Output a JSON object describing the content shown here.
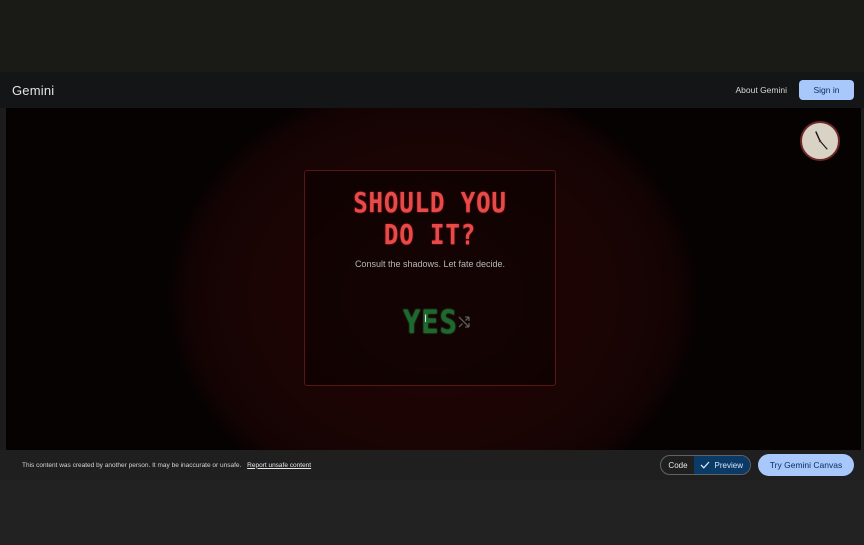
{
  "header": {
    "brand": "Gemini",
    "about_label": "About Gemini",
    "signin_label": "Sign in"
  },
  "app": {
    "title": "SHOULD YOU\nDO IT?",
    "subtitle": "Consult the shadows. Let fate decide.",
    "answer": "YES",
    "cursor_glyph": "I",
    "icons": {
      "clock": "clock-icon",
      "shuffle": "shuffle-icon"
    }
  },
  "footer": {
    "notice": "This content was created by another person. It may be inaccurate or unsafe.",
    "report_link": "Report unsafe content",
    "code_label": "Code",
    "preview_label": "Preview",
    "try_label": "Try Gemini Canvas"
  },
  "colors": {
    "accent_blue": "#a8c7fa",
    "title_red": "#e84a4a",
    "answer_green": "#1e6a2e",
    "preview_active": "#0b3a66"
  }
}
